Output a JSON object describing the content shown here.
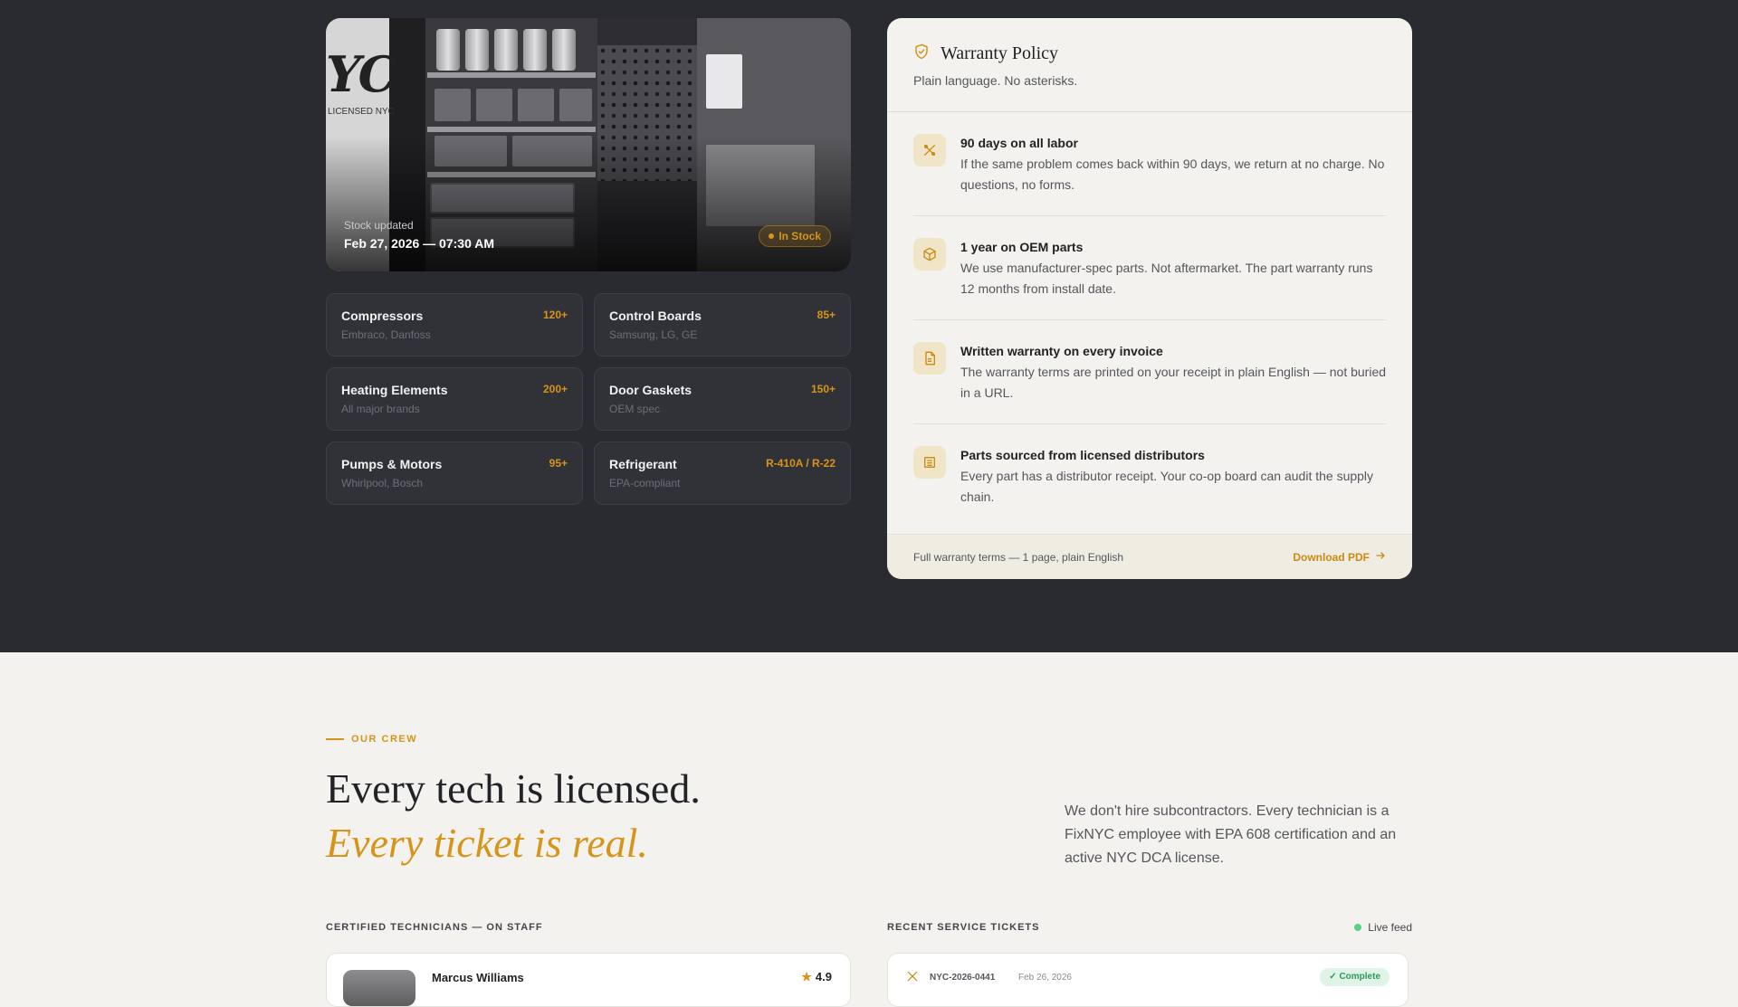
{
  "inventory": {
    "photo_van_text": "YC",
    "photo_van_subtext": "LICENSED NYC",
    "stock_label": "Stock updated",
    "stock_date": "Feb 27, 2026 — 07:30 AM",
    "stock_badge": "In Stock",
    "parts": [
      {
        "name": "Compressors",
        "brands": "Embraco, Danfoss",
        "count": "120+"
      },
      {
        "name": "Control Boards",
        "brands": "Samsung, LG, GE",
        "count": "85+"
      },
      {
        "name": "Heating Elements",
        "brands": "All major brands",
        "count": "200+"
      },
      {
        "name": "Door Gaskets",
        "brands": "OEM spec",
        "count": "150+"
      },
      {
        "name": "Pumps & Motors",
        "brands": "Whirlpool, Bosch",
        "count": "95+"
      },
      {
        "name": "Refrigerant",
        "brands": "EPA-compliant",
        "count": "R-410A / R-22"
      }
    ]
  },
  "warranty": {
    "title": "Warranty Policy",
    "subtitle": "Plain language. No asterisks.",
    "items": [
      {
        "icon": "tools-icon",
        "title": "90 days on all labor",
        "text": "If the same problem comes back within 90 days, we return at no charge. No questions, no forms."
      },
      {
        "icon": "box-icon",
        "title": "1 year on OEM parts",
        "text": "We use manufacturer-spec parts. Not aftermarket. The part warranty runs 12 months from install date."
      },
      {
        "icon": "document-icon",
        "title": "Written warranty on every invoice",
        "text": "The warranty terms are printed on your receipt in plain English — not buried in a URL."
      },
      {
        "icon": "building-icon",
        "title": "Parts sourced from licensed distributors",
        "text": "Every part has a distributor receipt. Your co-op board can audit the supply chain."
      }
    ],
    "footer_text": "Full warranty terms — 1 page, plain English",
    "download_label": "Download PDF"
  },
  "crew": {
    "eyebrow": "OUR CREW",
    "headline_1": "Every tech is licensed.",
    "headline_2": "Every ticket is real.",
    "description": "We don't hire subcontractors. Every technician is a FixNYC employee with EPA 608 certification and an active NYC DCA license.",
    "techs_label": "CERTIFIED TECHNICIANS — ON STAFF",
    "tickets_label": "RECENT SERVICE TICKETS",
    "live_label": "Live feed",
    "tech": {
      "name": "Marcus Williams",
      "rating": "4.9"
    },
    "ticket": {
      "id": "NYC-2026-0441",
      "date": "Feb 26, 2026",
      "status": "✓ Complete"
    }
  },
  "colors": {
    "accent": "#d6941a",
    "dark_bg": "#2a2b30",
    "light_bg": "#f3f2ee"
  }
}
